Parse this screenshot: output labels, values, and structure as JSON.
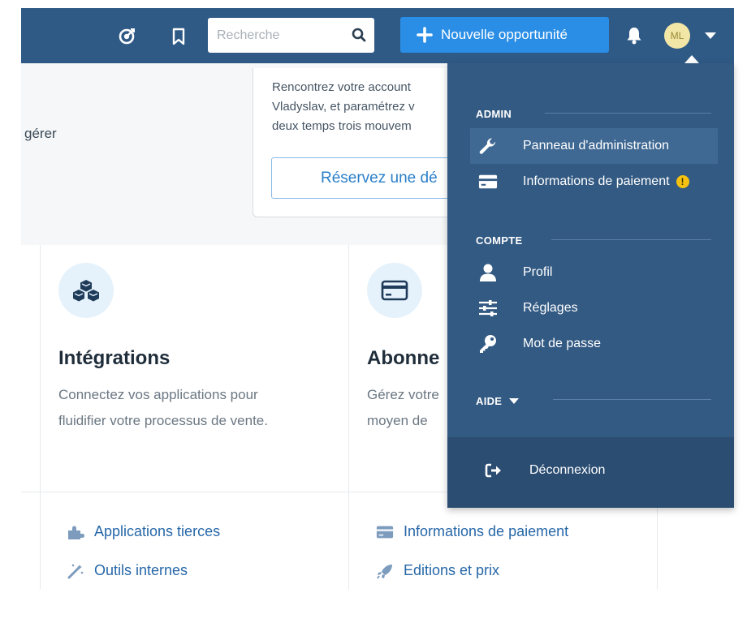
{
  "topbar": {
    "search_placeholder": "Recherche",
    "new_button_label": "Nouvelle opportunité",
    "avatar_initials": "ML",
    "colors": {
      "bar": "#2f5a86",
      "primary_button": "#2a8ee6"
    }
  },
  "background": {
    "partial_text": "gérer",
    "promo_text": "Rencontrez votre account\nVladyslav, et paramétrez v\ndeux temps trois mouvem",
    "promo_button": "Réservez une dé",
    "cards": [
      {
        "title": "Intégrations",
        "description": "Connectez vos applications pour\nfluidifier votre processus de vente."
      },
      {
        "title": "Abonne",
        "description": "Gérez votre\nmoyen de"
      }
    ],
    "links_left": [
      {
        "label": "Applications tierces",
        "icon": "puzzle-icon"
      },
      {
        "label": "Outils internes",
        "icon": "magic-wand-icon"
      }
    ],
    "links_right": [
      {
        "label": "Informations de paiement",
        "icon": "credit-card-icon"
      },
      {
        "label": "Editions et prix",
        "icon": "rocket-icon"
      }
    ]
  },
  "dropdown": {
    "sections": {
      "admin": "ADMIN",
      "compte": "COMPTE",
      "aide": "AIDE"
    },
    "admin_items": [
      {
        "label": "Panneau d'administration",
        "icon": "wrench-icon"
      },
      {
        "label": "Informations de paiement",
        "icon": "credit-card-icon",
        "warning": "!"
      }
    ],
    "compte_items": [
      {
        "label": "Profil",
        "icon": "user-icon"
      },
      {
        "label": "Réglages",
        "icon": "sliders-icon"
      },
      {
        "label": "Mot de passe",
        "icon": "key-icon"
      }
    ],
    "logout_label": "Déconnexion",
    "colors": {
      "panel": "#335a83",
      "footer": "#2b4d72",
      "warning": "#f5c211"
    }
  }
}
